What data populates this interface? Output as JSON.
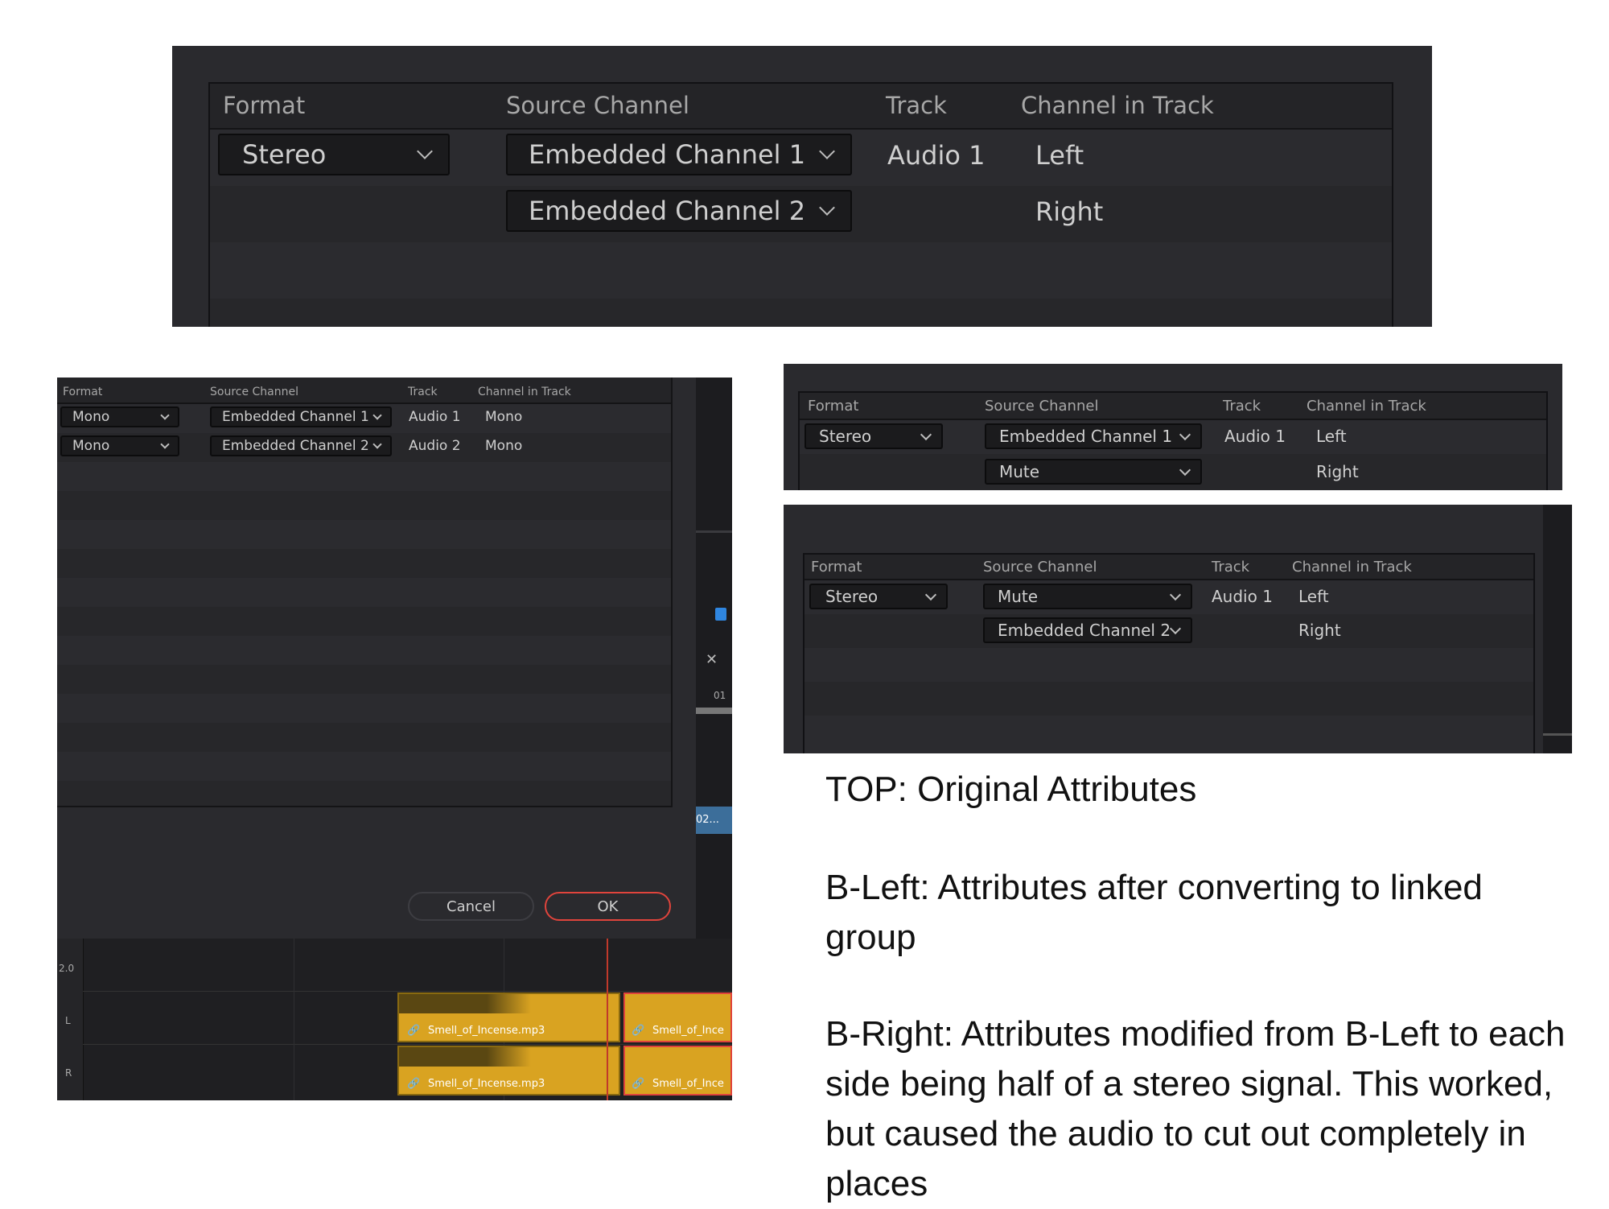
{
  "headers": {
    "format": "Format",
    "source_channel": "Source Channel",
    "track": "Track",
    "channel_in_track": "Channel in Track"
  },
  "top_panel": {
    "rows": [
      {
        "format": "Stereo",
        "source": "Embedded Channel 1",
        "track": "Audio 1",
        "channel": "Left"
      },
      {
        "source": "Embedded Channel 2",
        "channel": "Right"
      }
    ]
  },
  "bottom_left_panel": {
    "rows": [
      {
        "format": "Mono",
        "source": "Embedded Channel 1",
        "track": "Audio 1",
        "channel": "Mono"
      },
      {
        "format": "Mono",
        "source": "Embedded Channel 2",
        "track": "Audio 2",
        "channel": "Mono"
      }
    ],
    "cancel_label": "Cancel",
    "ok_label": "OK",
    "timeline": {
      "scale_label": "2.0",
      "left_label": "L",
      "right_label": "R",
      "clip_name": "Smell_of_Incense.mp3",
      "clip_name_cut": "Smell_of_Ince",
      "side_clip_label": "02...",
      "ruler_label": "01"
    }
  },
  "right_top_panel": {
    "rows": [
      {
        "format": "Stereo",
        "source": "Embedded Channel 1",
        "track": "Audio 1",
        "channel": "Left"
      },
      {
        "source": "Mute",
        "channel": "Right"
      }
    ]
  },
  "right_bottom_panel": {
    "rows": [
      {
        "format": "Stereo",
        "source": "Mute",
        "track": "Audio 1",
        "channel": "Left"
      },
      {
        "source": "Embedded Channel 2",
        "channel": "Right"
      }
    ]
  },
  "captions": {
    "top": "TOP: Original Attributes",
    "b_left": "B-Left: Attributes after converting to linked group",
    "b_right": "B-Right: Attributes modified from B-Left to each side being half of a stereo signal.  This worked, but caused the audio to cut out completely in places"
  },
  "colors": {
    "panel_bg": "#2a2a2e",
    "dropdown_bg": "#1b1b1d",
    "ok_border": "#e0443c",
    "clip_yellow": "#d9a321",
    "clip_red_border": "#e0443c",
    "playhead": "#c0392b"
  }
}
